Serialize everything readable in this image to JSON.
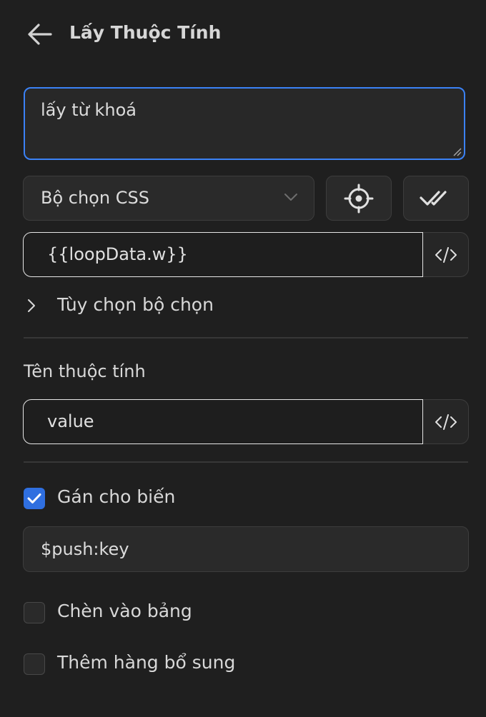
{
  "header": {
    "title": "Lấy Thuộc Tính",
    "back_icon": "arrow-left-icon"
  },
  "description": {
    "value": "lấy từ khoá"
  },
  "selector": {
    "type_value": "Bộ chọn CSS",
    "pick_icon": "crosshair-icon",
    "verify_icon": "double-check-icon",
    "value": "{{loopData.w}}",
    "code_icon": "code-icon",
    "options_label": "Tùy chọn bộ chọn",
    "options_icon": "chevron-right-icon"
  },
  "attribute": {
    "label": "Tên thuộc tính",
    "value": "value",
    "code_icon": "code-icon"
  },
  "assign_variable": {
    "label": "Gán cho biến",
    "checked": true,
    "value": "$push:key"
  },
  "insert_table": {
    "label": "Chèn vào bảng",
    "checked": false
  },
  "add_extra_row": {
    "label": "Thêm hàng bổ sung",
    "checked": false
  },
  "colors": {
    "background": "#1f1f1f",
    "accent": "#3b82f6",
    "checkbox_checked": "#2f6fe0"
  }
}
